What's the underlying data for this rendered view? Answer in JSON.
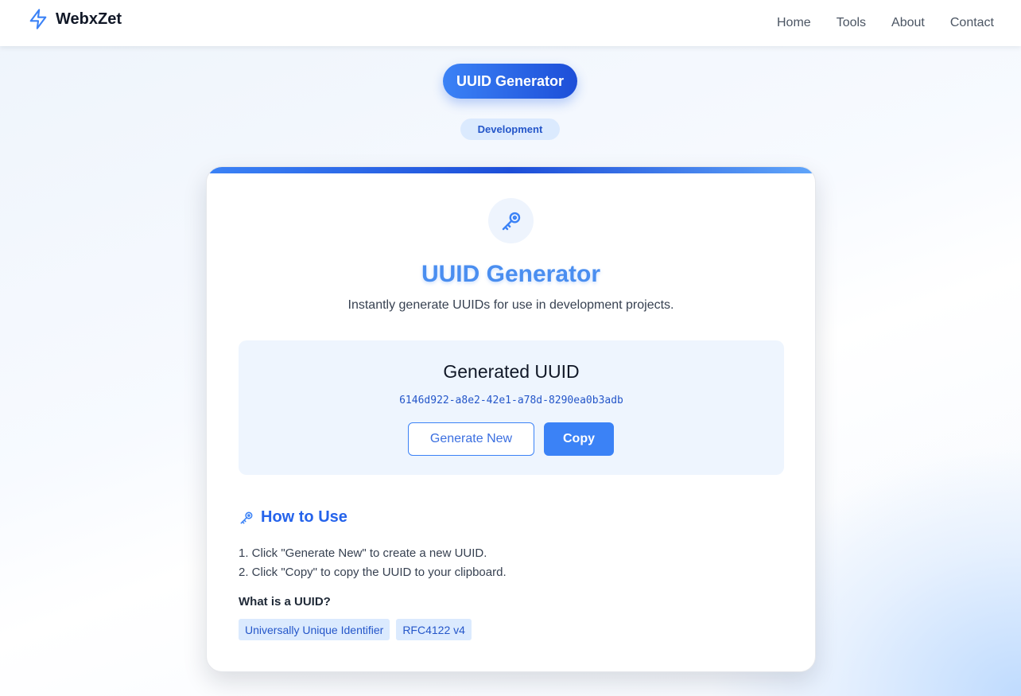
{
  "header": {
    "brand_name": "WebxZet",
    "brand_icon": "lightning-bolt-icon",
    "nav": [
      {
        "label": "Home"
      },
      {
        "label": "Tools"
      },
      {
        "label": "About"
      },
      {
        "label": "Contact"
      }
    ]
  },
  "hero": {
    "title_pill": "UUID Generator",
    "category": "Development"
  },
  "card": {
    "icon": "key-icon",
    "title": "UUID Generator",
    "subtitle": "Instantly generate UUIDs for use in development projects.",
    "result": {
      "heading": "Generated UUID",
      "uuid": "6146d922-a8e2-42e1-a78d-8290ea0b3adb",
      "generate_label": "Generate New",
      "copy_label": "Copy"
    },
    "how_to": {
      "title": "How to Use",
      "steps": [
        "1. Click \"Generate New\" to create a new UUID.",
        "2. Click \"Copy\" to copy the UUID to your clipboard."
      ],
      "what_title": "What is a UUID?",
      "tags": [
        "Universally Unique Identifier",
        "RFC4122 v4"
      ]
    }
  },
  "colors": {
    "accent": "#3b82f6",
    "accent_dark": "#1d4ed8",
    "tag_bg": "#dbeafe"
  }
}
